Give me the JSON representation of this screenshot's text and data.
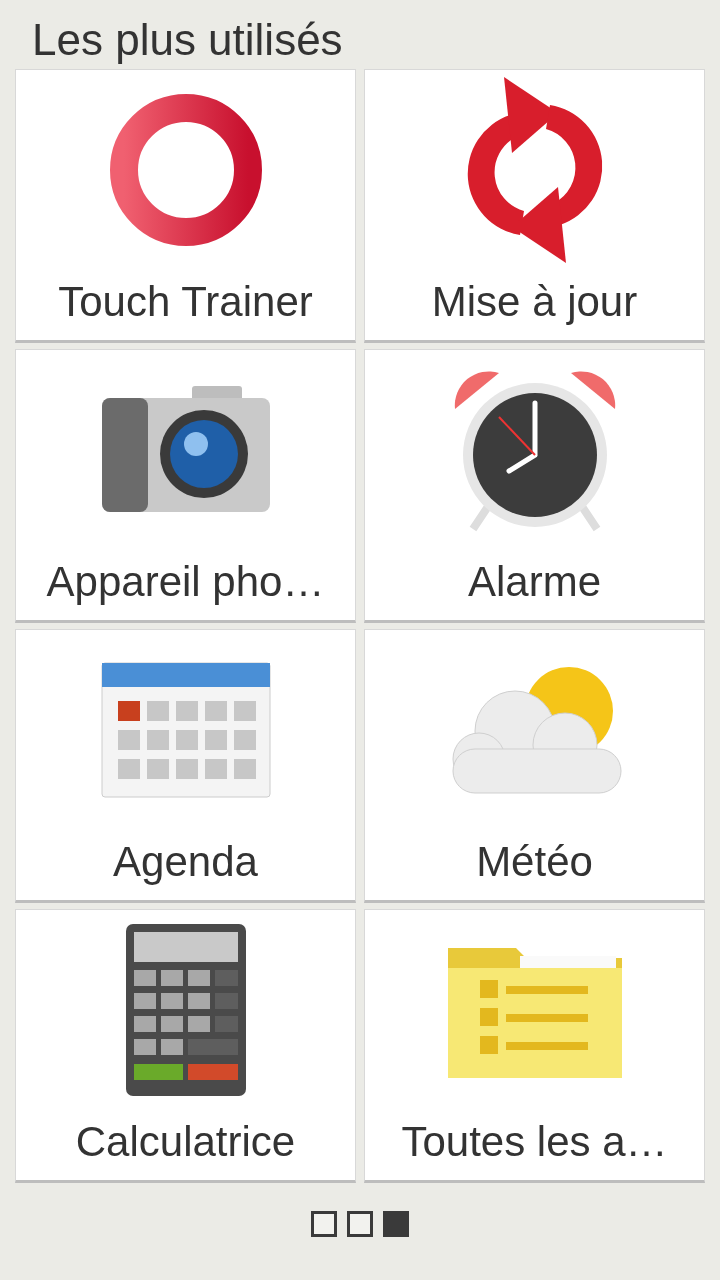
{
  "title": "Les plus utilisés",
  "tiles": [
    {
      "label": "Touch Trainer",
      "kind": "ring"
    },
    {
      "label": "Mise à jour",
      "kind": "refresh"
    },
    {
      "label": "Appareil pho…",
      "kind": "camera"
    },
    {
      "label": "Alarme",
      "kind": "alarm"
    },
    {
      "label": "Agenda",
      "kind": "calendar"
    },
    {
      "label": "Météo",
      "kind": "weather"
    },
    {
      "label": "Calculatrice",
      "kind": "calculator"
    },
    {
      "label": "Toutes les a…",
      "kind": "folder"
    }
  ],
  "pages": [
    {
      "selected": false
    },
    {
      "selected": false
    },
    {
      "selected": true
    }
  ]
}
